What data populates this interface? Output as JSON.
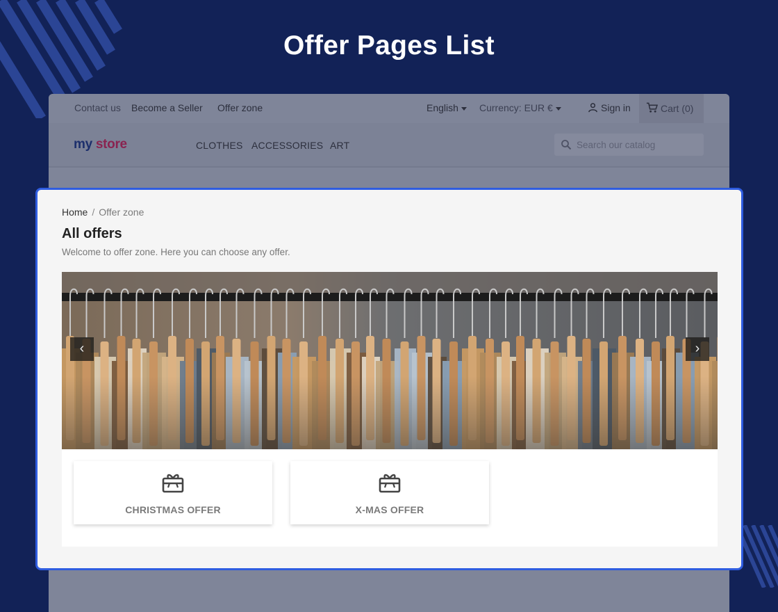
{
  "heading": "Offer Pages List",
  "topbar": {
    "contact": "Contact us",
    "seller": "Become a Seller",
    "offer_zone": "Offer zone",
    "language": "English",
    "currency": "Currency: EUR €",
    "sign_in": "Sign in",
    "cart": "Cart (0)"
  },
  "logo": {
    "part1": "my",
    "part2": "store"
  },
  "nav": [
    "CLOTHES",
    "ACCESSORIES",
    "ART"
  ],
  "search": {
    "placeholder": "Search our catalog"
  },
  "breadcrumb": {
    "home": "Home",
    "separator": "/",
    "current": "Offer zone"
  },
  "page": {
    "title": "All offers",
    "subtitle": "Welcome to offer zone. Here you can choose any offer."
  },
  "carousel": {
    "prev": "‹",
    "next": "›"
  },
  "offers": [
    {
      "label": "CHRISTMAS OFFER",
      "icon": "gift-card-icon"
    },
    {
      "label": "X-MAS OFFER",
      "icon": "gift-card-icon"
    }
  ],
  "colors": {
    "background": "#122257",
    "highlight_border": "#2f5de0"
  }
}
